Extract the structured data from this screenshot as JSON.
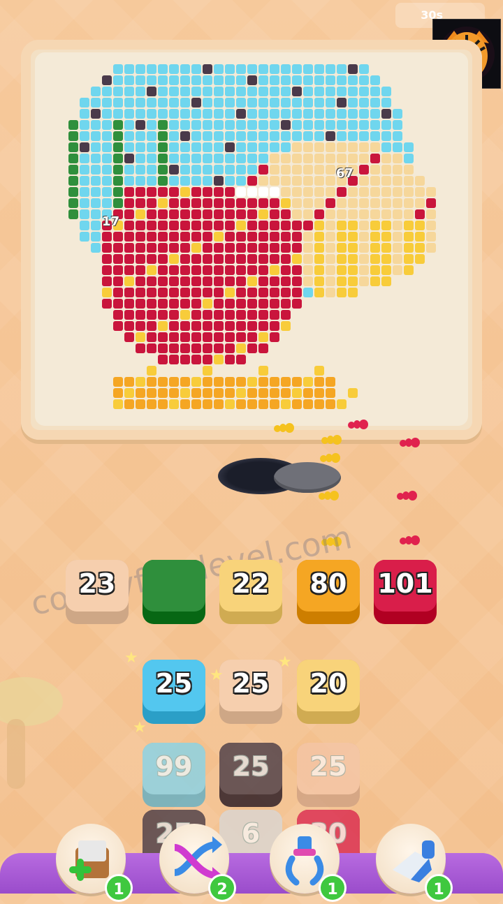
{
  "header": {
    "timer": "30s",
    "avatar": "tiger-avatar"
  },
  "board": {
    "hint_left": "17",
    "hint_right": "67",
    "colors": {
      "cyan": "#6fd6ee",
      "green": "#2f8f3c",
      "red": "#c9153c",
      "yellow": "#f8cc3a",
      "orange": "#f5a623",
      "cream": "#f6d79b",
      "dark": "#4a3a4a",
      "white": "#ffffff",
      "beige": "#f1e4c8"
    }
  },
  "queue": [
    {
      "label": "23",
      "color": "#f6cfae"
    },
    {
      "label": "",
      "color": "#2f8f3c"
    },
    {
      "label": "22",
      "color": "#f8d37a"
    },
    {
      "label": "80",
      "color": "#f5a623"
    },
    {
      "label": "101",
      "color": "#d91e4a"
    }
  ],
  "grid_row1": [
    {
      "label": "25",
      "color": "#53c7ef"
    },
    {
      "label": "25",
      "color": "#f6cfae"
    },
    {
      "label": "20",
      "color": "#f8d37a"
    }
  ],
  "grid_row2": [
    {
      "label": "99",
      "color": "#7fd5ef"
    },
    {
      "label": "25",
      "color": "#3e3240"
    },
    {
      "label": "25",
      "color": "#f4c6a8"
    }
  ],
  "grid_row3": [
    {
      "label": "25",
      "color": "#3e3240"
    },
    {
      "label": "6",
      "color": "#d9d9d9"
    },
    {
      "label": "30",
      "color": "#d91e4a"
    }
  ],
  "watermark": "colonyflowlevel.com",
  "tools": [
    {
      "name": "add-box-icon",
      "count": "1"
    },
    {
      "name": "shuffle-arrows-icon",
      "count": "2"
    },
    {
      "name": "magnet-claw-icon",
      "count": "1"
    },
    {
      "name": "vacuum-icon",
      "count": "1"
    }
  ]
}
